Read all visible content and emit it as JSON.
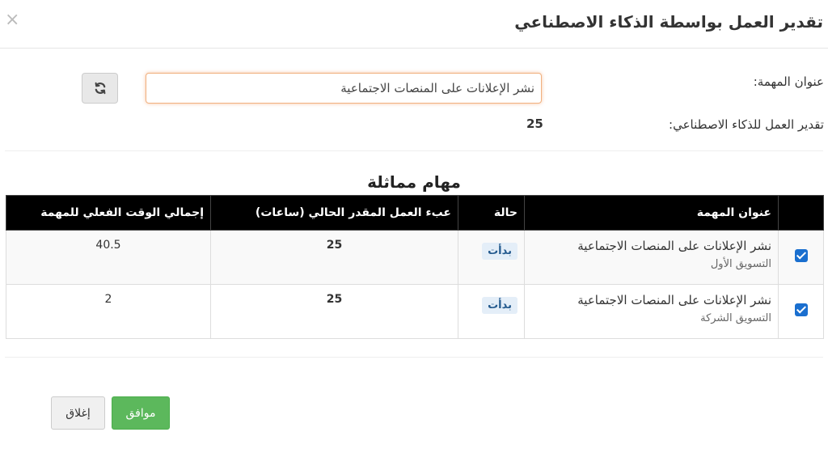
{
  "header": {
    "title": "تقدير العمل بواسطة الذكاء الاصطناعي",
    "close_label": "×"
  },
  "form": {
    "task_title_label": "عنوان المهمة:",
    "task_title_value": "نشر الإعلانات على المنصات الاجتماعية",
    "ai_estimate_label": "تقدير العمل للذكاء الاصطناعي:",
    "ai_estimate_value": "25",
    "refresh_icon": "refresh-icon"
  },
  "similar": {
    "title": "مهام مماثلة",
    "columns": [
      "عنوان المهمة",
      "حالة",
      "عبء العمل المقدر الحالي (ساعات)",
      "إجمالي الوقت الفعلي للمهمة"
    ],
    "rows": [
      {
        "checked": true,
        "name": "نشر الإعلانات على المنصات الاجتماعية",
        "project": "التسويق الأول",
        "status": "بدأت",
        "estimate": "25",
        "actual": "40.5"
      },
      {
        "checked": true,
        "name": "نشر الإعلانات على المنصات الاجتماعية",
        "project": "التسويق الشركة",
        "status": "بدأت",
        "estimate": "25",
        "actual": "2"
      }
    ]
  },
  "footer": {
    "ok_label": "موافق",
    "close_label": "إغلاق"
  },
  "colors": {
    "table_header_bg": "#000000",
    "ok_button": "#5cb85c",
    "checkbox": "#1a6fcf",
    "status_badge_bg": "#e4eef8",
    "input_focus_border": "#f0b07e"
  }
}
